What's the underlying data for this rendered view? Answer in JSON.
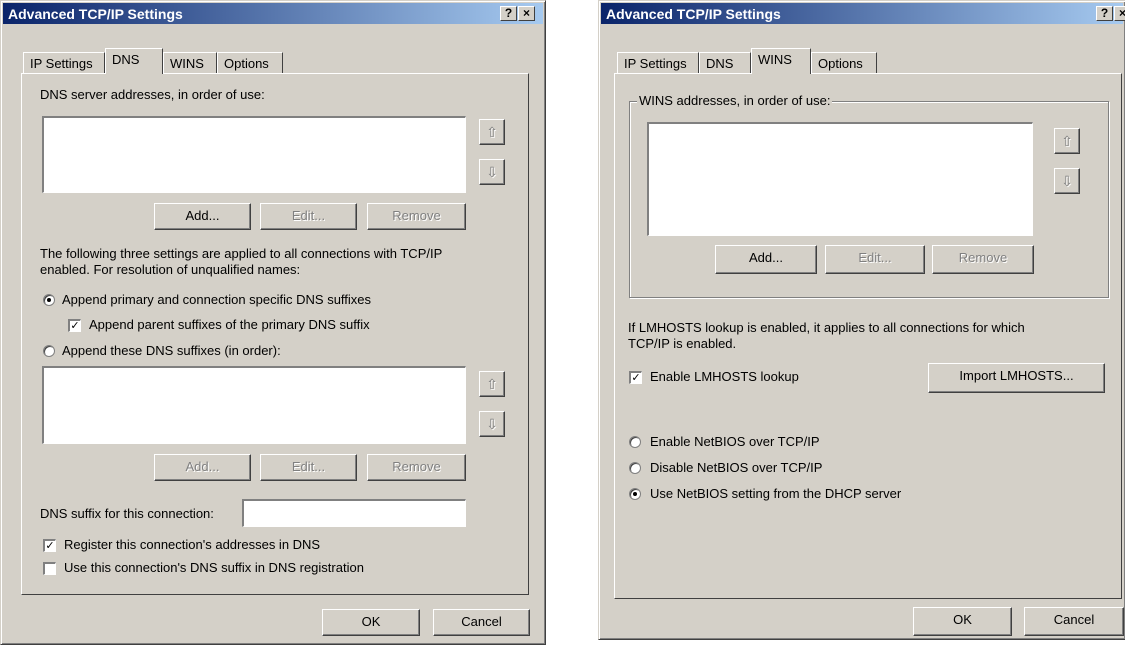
{
  "dns_window": {
    "title": "Advanced TCP/IP Settings",
    "help_btn": "?",
    "close_btn": "×",
    "tabs": [
      "IP Settings",
      "DNS",
      "WINS",
      "Options"
    ],
    "server_label": "DNS server addresses, in order of use:",
    "add": "Add...",
    "edit": "Edit...",
    "remove": "Remove",
    "desc": "The following three settings are applied to all connections with TCP/IP",
    "desc2": "enabled. For resolution of unqualified names:",
    "radio_primary": "Append primary and connection specific DNS suffixes",
    "check_parent": "Append parent suffixes of the primary DNS suffix",
    "radio_these": "Append these DNS suffixes (in order):",
    "add2": "Add...",
    "edit2": "Edit...",
    "remove2": "Remove",
    "suffix_label": "DNS suffix for this connection:",
    "suffix_value": "",
    "check_register": "Register this connection's addresses in DNS",
    "check_use_suffix": "Use this connection's DNS suffix in DNS registration",
    "ok": "OK",
    "cancel": "Cancel"
  },
  "wins_window": {
    "title": "Advanced TCP/IP Settings",
    "help_btn": "?",
    "close_btn": "×",
    "tabs": [
      "IP Settings",
      "DNS",
      "WINS",
      "Options"
    ],
    "group_label": "WINS addresses, in order of use:",
    "add": "Add...",
    "edit": "Edit...",
    "remove": "Remove",
    "lmhosts_desc": "If LMHOSTS lookup is enabled, it applies to all connections for which",
    "lmhosts_desc2": "TCP/IP is enabled.",
    "check_lmhosts": "Enable LMHOSTS lookup",
    "import_lmhosts": "Import LMHOSTS...",
    "radio_enable": "Enable NetBIOS over TCP/IP",
    "radio_disable": "Disable NetBIOS over TCP/IP",
    "radio_dhcp": "Use NetBIOS setting from the DHCP server",
    "ok": "OK",
    "cancel": "Cancel"
  },
  "icons": {
    "up_arrow": "⇧",
    "down_arrow": "⇩",
    "check": "✓"
  },
  "colors": {
    "title_start": "#0a246a",
    "title_end": "#a6caf0",
    "face": "#d4d0c8"
  }
}
